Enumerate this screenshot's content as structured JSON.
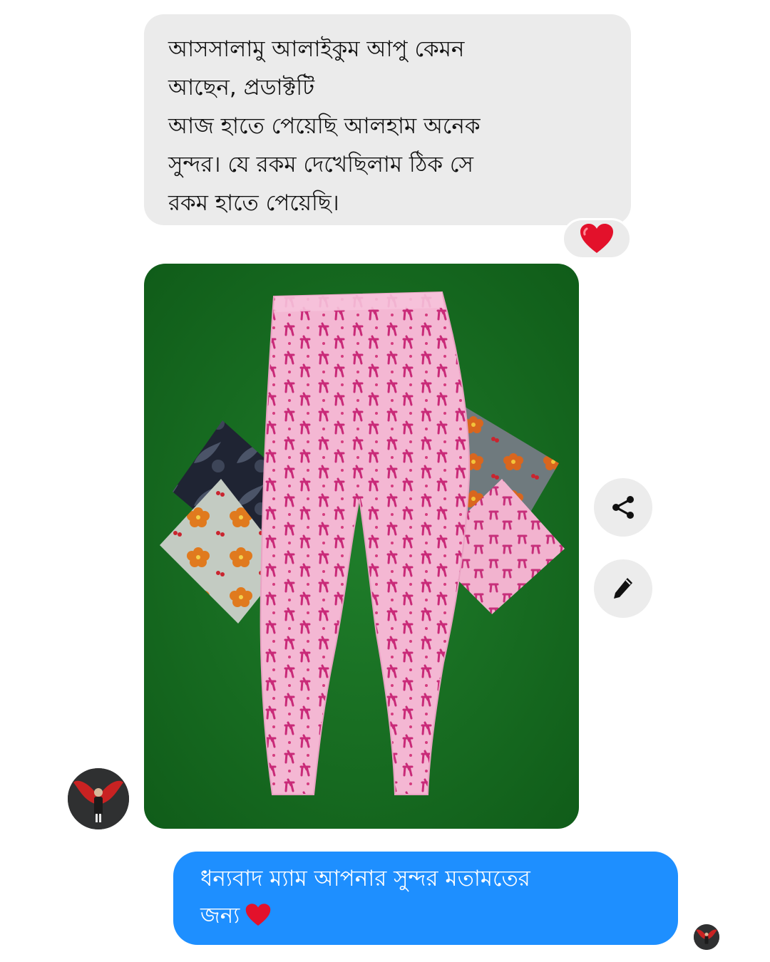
{
  "incoming_message": {
    "lines": [
      "আসসালামু আলাইকুম আপু কেমন",
      "আছেন, প্রডাক্টটি",
      "আজ হাতে পেয়েছি আলহাম অনেক",
      "সুন্দর।  যে রকম দেখেছিলাম ঠিক সে",
      "রকম হাতে পেয়েছি।"
    ],
    "reaction_icon": "red-heart-icon",
    "bubble_color": "#ebebeb"
  },
  "photo_attachment": {
    "icon": "product-photo",
    "background_color": "#15661f"
  },
  "side_actions": {
    "share_icon": "share-icon",
    "edit_icon": "pencil-icon"
  },
  "outgoing_message": {
    "line1": "ধন্যবাদ ম্যাম আপনার সুন্দর মতামতের",
    "line2": "জন্য",
    "heart_icon": "red-heart-icon",
    "bubble_color": "#1e8fff"
  },
  "colors": {
    "outgoing_bubble": "#1e8fff",
    "incoming_bubble": "#ebebeb",
    "heart": "#e3112b"
  }
}
